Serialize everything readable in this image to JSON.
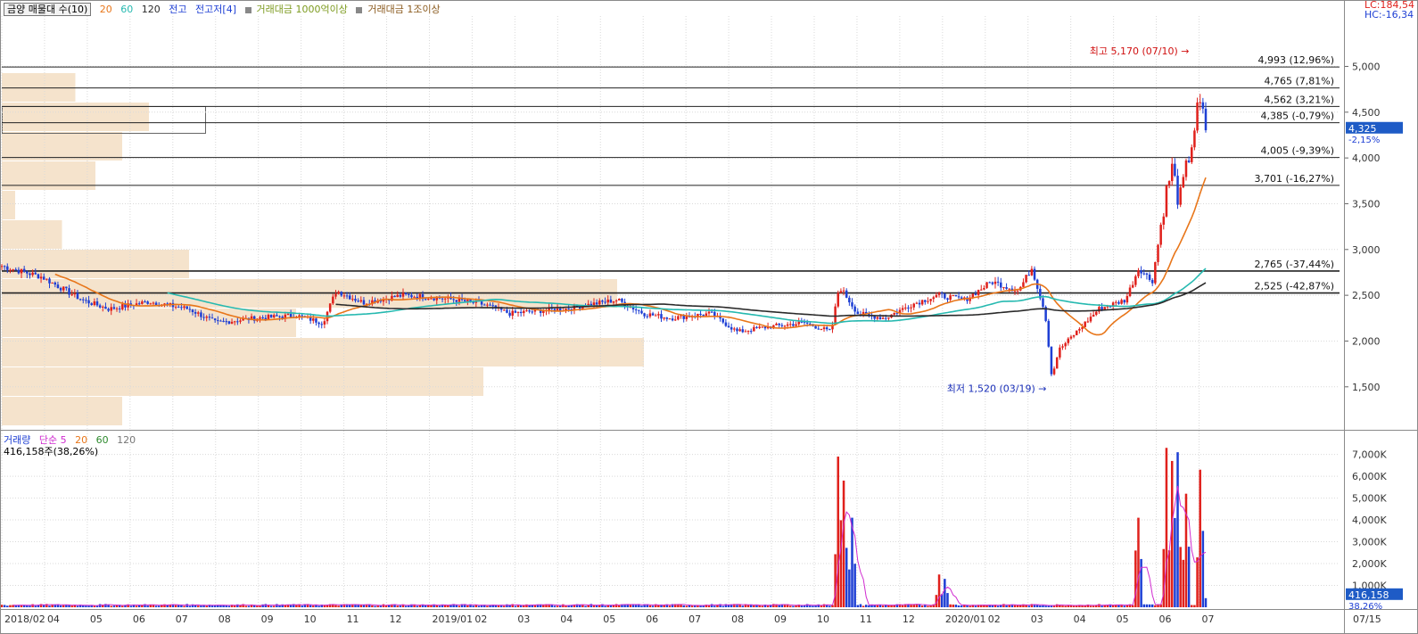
{
  "header": {
    "stock_label": "금양 매물대 수(10)",
    "ma_20": "20",
    "ma_60": "60",
    "ma_120": "120",
    "jeongo": "전고",
    "jeongojeo": "전고저[4]",
    "vol_filter_1": "거래대금 1000억이상",
    "vol_filter_2": "거래대금 1조이상",
    "lc": "LC:184,54",
    "hc": "HC:-16,34"
  },
  "volume_header": {
    "label": "거래량",
    "simple": "단순 5",
    "ma_20": "20",
    "ma_60": "60",
    "ma_120": "120",
    "current": "416,158주(38,26%)"
  },
  "colors": {
    "up": "#e0211c",
    "down": "#1e3fd4",
    "ma5": "#d02bd0",
    "ma20": "#e8761a",
    "ma60": "#26b9b0",
    "ma120": "#2a2a2a",
    "volume_profile": "#f5e3cc",
    "grid": "#d9d9d9"
  },
  "annotations": {
    "high": "최고 5,170 (07/10)",
    "low": "최저 1,520 (03/19)"
  },
  "price_levels": [
    {
      "value": 4993,
      "label": "4,993 (12,96%)"
    },
    {
      "value": 4765,
      "label": "4,765 (7,81%)"
    },
    {
      "value": 4562,
      "label": "4,562 (3,21%)"
    },
    {
      "value": 4385,
      "label": "4,385 (-0,79%)"
    },
    {
      "value": 4005,
      "label": "4,005 (-9,39%)"
    },
    {
      "value": 3701,
      "label": "3,701 (-16,27%)"
    },
    {
      "value": 2765,
      "label": "2,765 (-37,44%)"
    },
    {
      "value": 2525,
      "label": "2,525 (-42,87%)"
    }
  ],
  "current_price": {
    "label": "4,325",
    "change": "-2,15%"
  },
  "current_volume": {
    "label": "416,158",
    "change": "38,26%"
  },
  "chart_data": {
    "type": "candlestick",
    "x_ticks": [
      "2018/02",
      "04",
      "05",
      "06",
      "07",
      "08",
      "09",
      "10",
      "11",
      "12",
      "2019/01",
      "02",
      "03",
      "04",
      "05",
      "06",
      "07",
      "08",
      "09",
      "10",
      "11",
      "12",
      "2020/01",
      "02",
      "03",
      "04",
      "05",
      "06",
      "07",
      "07/15"
    ],
    "y_ticks": [
      "1,500",
      "2,000",
      "2,500",
      "3,000",
      "3,500",
      "4,000",
      "4,500",
      "5,000"
    ],
    "ylim": [
      1050,
      5550
    ],
    "volume_y_ticks": [
      "1,000K",
      "2,000K",
      "3,000K",
      "4,000K",
      "5,000K",
      "6,000K",
      "7,000K"
    ],
    "volume_ylim": [
      0,
      7800000
    ],
    "price_anchors": [
      [
        0,
        2820
      ],
      [
        0.03,
        2700
      ],
      [
        0.06,
        2450
      ],
      [
        0.08,
        2350
      ],
      [
        0.11,
        2430
      ],
      [
        0.14,
        2350
      ],
      [
        0.16,
        2200
      ],
      [
        0.19,
        2250
      ],
      [
        0.22,
        2280
      ],
      [
        0.24,
        2200
      ],
      [
        0.25,
        2550
      ],
      [
        0.27,
        2420
      ],
      [
        0.3,
        2500
      ],
      [
        0.32,
        2480
      ],
      [
        0.34,
        2450
      ],
      [
        0.36,
        2400
      ],
      [
        0.38,
        2300
      ],
      [
        0.4,
        2330
      ],
      [
        0.42,
        2350
      ],
      [
        0.44,
        2400
      ],
      [
        0.46,
        2450
      ],
      [
        0.48,
        2300
      ],
      [
        0.5,
        2250
      ],
      [
        0.53,
        2300
      ],
      [
        0.55,
        2100
      ],
      [
        0.57,
        2150
      ],
      [
        0.6,
        2200
      ],
      [
        0.62,
        2100
      ],
      [
        0.626,
        2600
      ],
      [
        0.64,
        2300
      ],
      [
        0.66,
        2250
      ],
      [
        0.68,
        2400
      ],
      [
        0.7,
        2500
      ],
      [
        0.72,
        2450
      ],
      [
        0.74,
        2650
      ],
      [
        0.76,
        2550
      ],
      [
        0.77,
        2800
      ],
      [
        0.78,
        2300
      ],
      [
        0.785,
        1600
      ],
      [
        0.79,
        1900
      ],
      [
        0.8,
        2050
      ],
      [
        0.81,
        2200
      ],
      [
        0.82,
        2350
      ],
      [
        0.84,
        2450
      ],
      [
        0.85,
        2800
      ],
      [
        0.86,
        2650
      ],
      [
        0.87,
        3600
      ],
      [
        0.875,
        3900
      ],
      [
        0.88,
        3500
      ],
      [
        0.89,
        4200
      ],
      [
        0.895,
        4600
      ],
      [
        0.9,
        4325
      ]
    ],
    "volume_spikes": [
      [
        0.626,
        6900000
      ],
      [
        0.63,
        5800000
      ],
      [
        0.635,
        4100000
      ],
      [
        0.7,
        1500000
      ],
      [
        0.705,
        1300000
      ],
      [
        0.85,
        4100000
      ],
      [
        0.87,
        7300000
      ],
      [
        0.875,
        6700000
      ],
      [
        0.88,
        7100000
      ],
      [
        0.885,
        5200000
      ],
      [
        0.895,
        6300000
      ],
      [
        0.9,
        416158
      ]
    ],
    "volume_profile": [
      [
        5.5,
        1.0
      ],
      [
        11,
        1.7
      ],
      [
        9,
        1.85
      ],
      [
        7,
        3.4
      ],
      [
        1,
        4.25
      ],
      [
        4.5,
        5.5
      ],
      [
        14,
        6.5
      ],
      [
        46,
        7.7
      ],
      [
        22,
        8.4
      ],
      [
        48,
        9.1
      ],
      [
        36,
        9.8
      ],
      [
        9,
        10.6
      ]
    ]
  }
}
